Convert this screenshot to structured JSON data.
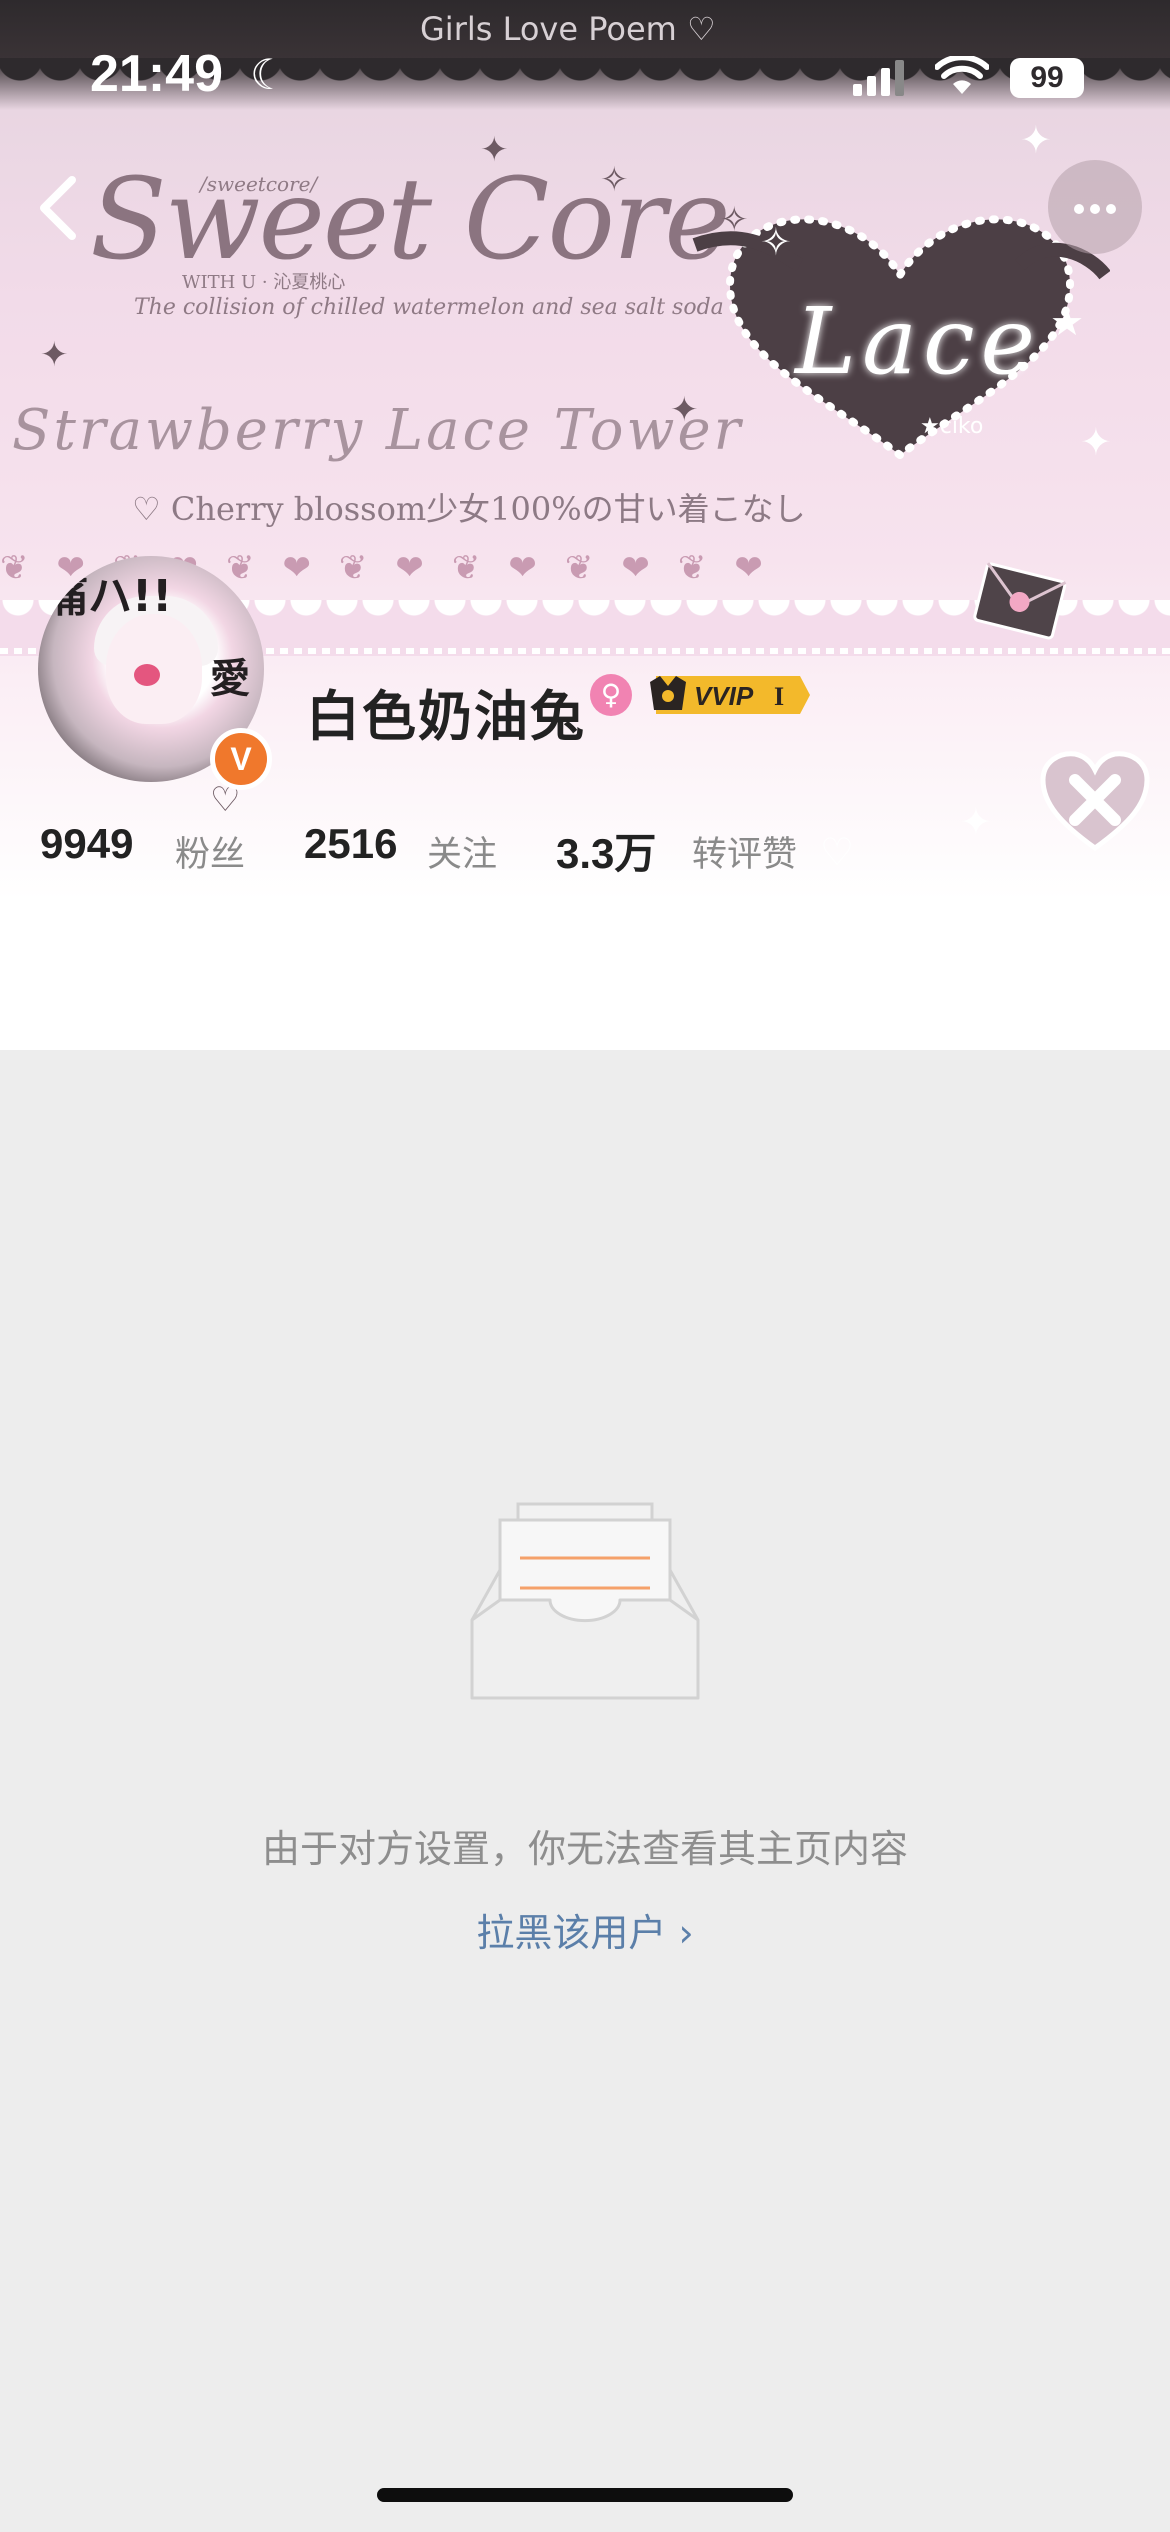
{
  "status_bar": {
    "time": "21:49",
    "battery": "99",
    "moon_icon": "moon-icon",
    "signal_icon": "cellular-signal-icon",
    "wifi_icon": "wifi-icon"
  },
  "banner": {
    "ribbon_title": "Girls Love Poem ♡",
    "sub_small": "/sweetcore/",
    "title": "Sweet Core",
    "with_u": "WITH U · 沁夏桃心",
    "tagline": "The collision of chilled watermelon and sea salt soda",
    "tower": "Strawberry Lace Tower",
    "cherry_line": "♡ Cherry blossom少女100%の甘い着こなし",
    "heart_text": "Lace",
    "heart_small": "★ciko"
  },
  "profile": {
    "avatar_text_1": "痛ハ!!",
    "avatar_text_2": "愛",
    "verified_mark": "V",
    "username": "白色奶油兔",
    "gender_symbol": "♀",
    "vip_label": "VVIP",
    "vip_level": "I",
    "colors": {
      "verified": "#f0782c",
      "gender": "#f183b2",
      "vip": "#f3b92b"
    }
  },
  "stats": [
    {
      "value": "9949",
      "label": "粉丝"
    },
    {
      "value": "2516",
      "label": "关注"
    },
    {
      "value": "3.3万",
      "label": "转评赞"
    }
  ],
  "empty_state": {
    "message": "由于对方设置，你无法查看其主页内容",
    "block_link": "拉黑该用户 ›",
    "link_color": "#5b7fa9"
  }
}
